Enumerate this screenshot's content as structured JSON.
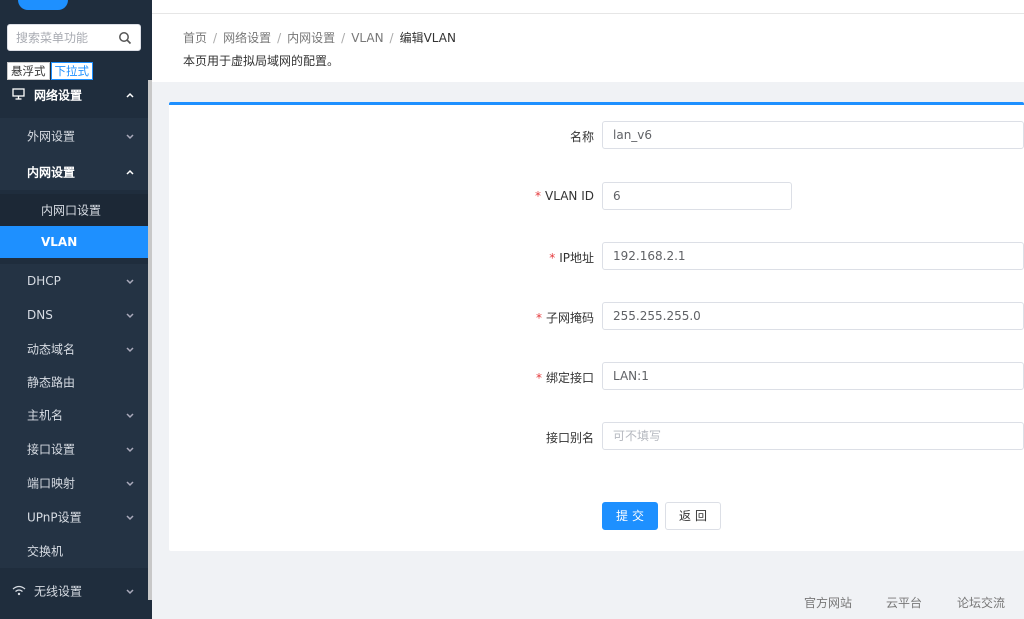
{
  "sidebar": {
    "search_placeholder": "搜索菜单功能",
    "mode_float": "悬浮式",
    "mode_dropdown": "下拉式",
    "items": [
      {
        "label": "网络设置"
      },
      {
        "label": "外网设置"
      },
      {
        "label": "内网设置"
      },
      {
        "label": "内网口设置"
      },
      {
        "label": "VLAN"
      },
      {
        "label": "DHCP"
      },
      {
        "label": "DNS"
      },
      {
        "label": "动态域名"
      },
      {
        "label": "静态路由"
      },
      {
        "label": "主机名"
      },
      {
        "label": "接口设置"
      },
      {
        "label": "端口映射"
      },
      {
        "label": "UPnP设置"
      },
      {
        "label": "交换机"
      },
      {
        "label": "无线设置"
      }
    ]
  },
  "breadcrumb": {
    "items": [
      "首页",
      "网络设置",
      "内网设置",
      "VLAN",
      "编辑VLAN"
    ],
    "sep": "/"
  },
  "page_desc": "本页用于虚拟局域网的配置。",
  "form": {
    "name": {
      "label": "名称",
      "value": "lan_v6"
    },
    "vlan_id": {
      "label": "VLAN ID",
      "value": "6",
      "required": "*"
    },
    "ip": {
      "label": "IP地址",
      "value": "192.168.2.1",
      "required": "*"
    },
    "mask": {
      "label": "子网掩码",
      "value": "255.255.255.0",
      "required": "*"
    },
    "bind": {
      "label": "绑定接口",
      "value": "LAN:1",
      "required": "*"
    },
    "alias": {
      "label": "接口别名",
      "placeholder": "可不填写"
    }
  },
  "buttons": {
    "submit": "提交",
    "back": "返回"
  },
  "footer": {
    "site": "官方网站",
    "cloud": "云平台",
    "forum": "论坛交流"
  },
  "colors": {
    "accent": "#1e90ff",
    "sidebar_bg": "#1f2d3d",
    "required": "#e4393c"
  }
}
